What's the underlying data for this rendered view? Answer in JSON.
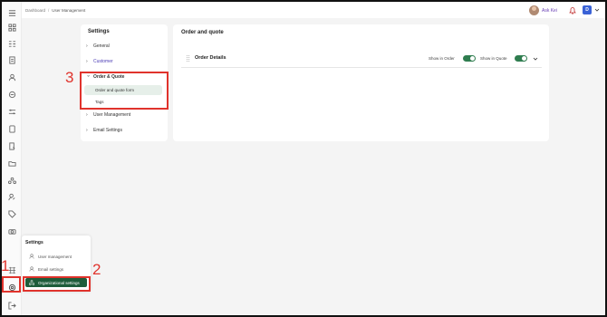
{
  "breadcrumb": {
    "root": "Dashboard",
    "separator": "/",
    "current": "User Management"
  },
  "header": {
    "user_name": "Ask Kei",
    "account_badge": "D"
  },
  "settings_panel": {
    "title": "Settings",
    "items": [
      {
        "label": "General"
      },
      {
        "label": "Customer"
      },
      {
        "label": "Order & Quote"
      },
      {
        "label": "User Management"
      },
      {
        "label": "Email Settings"
      }
    ],
    "sub_items": [
      {
        "label": "Order and quote form"
      },
      {
        "label": "Tags"
      }
    ]
  },
  "content": {
    "title": "Order and quote",
    "row_label": "Order Details",
    "toggle_order_label": "Show in Order",
    "toggle_quote_label": "Show in Quote"
  },
  "popup": {
    "title": "Settings",
    "items": [
      {
        "label": "User management"
      },
      {
        "label": "Email settings"
      },
      {
        "label": "Organizational settings"
      }
    ]
  },
  "annotations": {
    "one": "1",
    "two": "2",
    "three": "3"
  },
  "colors": {
    "accent_green": "#2f7d4f",
    "annotation_red": "#e0332c",
    "purple_link": "#4b3cb5"
  },
  "icons": {
    "rail": [
      "home-icon",
      "grid-icon",
      "document-icon",
      "user-icon",
      "layers-icon",
      "sliders-icon",
      "file-icon",
      "upload-icon",
      "folder-icon",
      "org-chart-icon",
      "user-edit-icon",
      "tag-icon",
      "camera-icon",
      "apps-icon",
      "settings-icon",
      "logout-icon"
    ]
  }
}
